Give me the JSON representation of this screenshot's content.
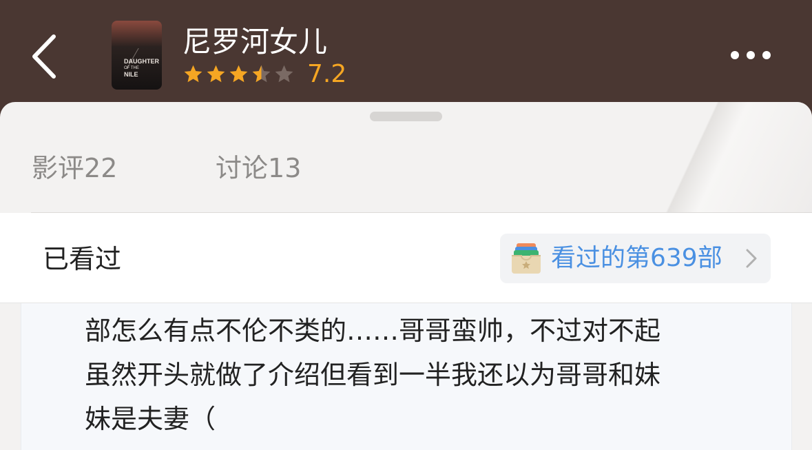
{
  "header": {
    "title": "尼罗河女儿",
    "rating": "7.2",
    "rating_stars": 3.5,
    "poster_title": "DAUGHTER",
    "poster_sub": "OF THE",
    "poster_title2": "NILE",
    "back_icon": "chevron-left-icon",
    "more_icon": "more-icon"
  },
  "tabs": [
    {
      "label": "影评",
      "count": "22"
    },
    {
      "label": "讨论",
      "count": "13"
    }
  ],
  "watched": {
    "label": "已看过",
    "count_text": "看过的第639部"
  },
  "comment": {
    "lines": [
      "部怎么有点不伦不类的……哥哥蛮帅，不过对不起",
      "虽然开头就做了介绍但看到一半我还以为哥哥和妹",
      "妹是夫妻（"
    ]
  },
  "colors": {
    "header_bg": "#4a3732",
    "star": "#f5a623",
    "link": "#4a90e2"
  }
}
